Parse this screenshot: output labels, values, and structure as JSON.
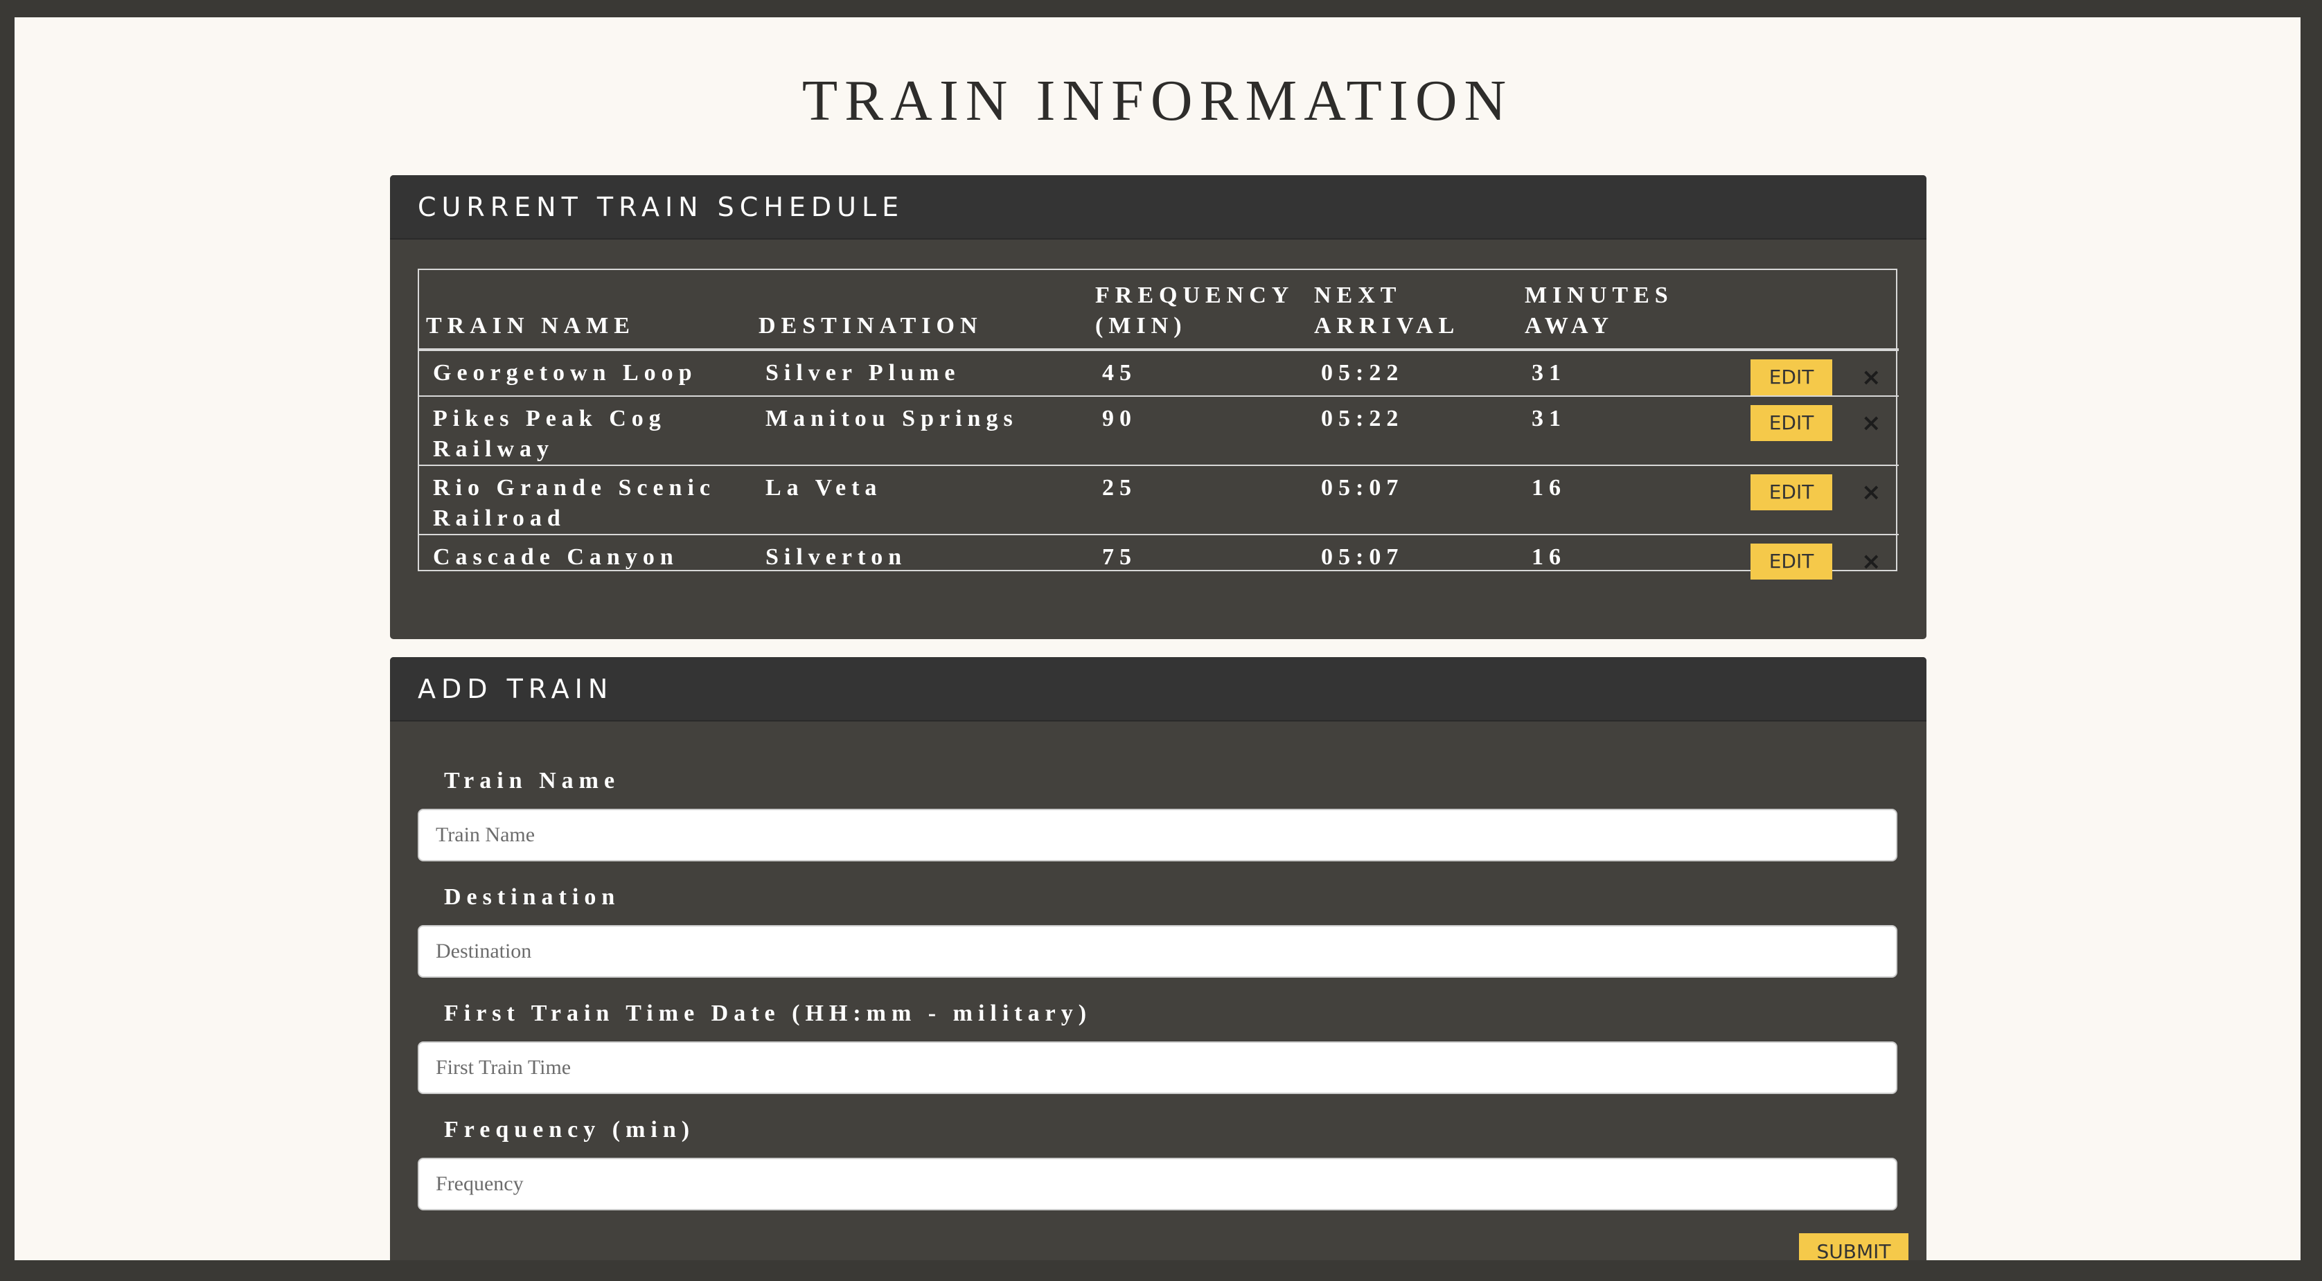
{
  "page": {
    "title": "TRAIN INFORMATION"
  },
  "schedule": {
    "heading": "CURRENT TRAIN SCHEDULE",
    "columns": [
      "TRAIN NAME",
      "DESTINATION",
      "FREQUENCY (MIN)",
      "NEXT ARRIVAL",
      "MINUTES AWAY"
    ],
    "edit_label": "EDIT",
    "delete_label": "×",
    "rows": [
      {
        "name": "Georgetown Loop",
        "destination": "Silver Plume",
        "frequency": "45",
        "next_arrival": "05:22",
        "minutes_away": "31"
      },
      {
        "name": "Pikes Peak Cog Railway",
        "destination": "Manitou Springs",
        "frequency": "90",
        "next_arrival": "05:22",
        "minutes_away": "31"
      },
      {
        "name": "Rio Grande Scenic Railroad",
        "destination": "La Veta",
        "frequency": "25",
        "next_arrival": "05:07",
        "minutes_away": "16"
      },
      {
        "name": "Cascade Canyon",
        "destination": "Silverton",
        "frequency": "75",
        "next_arrival": "05:07",
        "minutes_away": "16"
      }
    ]
  },
  "add_train": {
    "heading": "ADD TRAIN",
    "fields": [
      {
        "label": "Train Name",
        "placeholder": "Train Name"
      },
      {
        "label": "Destination",
        "placeholder": "Destination"
      },
      {
        "label": "First Train Time Date (HH:mm - military)",
        "placeholder": "First Train Time"
      },
      {
        "label": "Frequency (min)",
        "placeholder": "Frequency"
      }
    ],
    "submit_label": "SUBMIT"
  },
  "colors": {
    "accent": "#f5c94a",
    "panel": "#43413d",
    "heading": "#343434",
    "frame": "#3a3935",
    "background": "#fbf8f3"
  }
}
